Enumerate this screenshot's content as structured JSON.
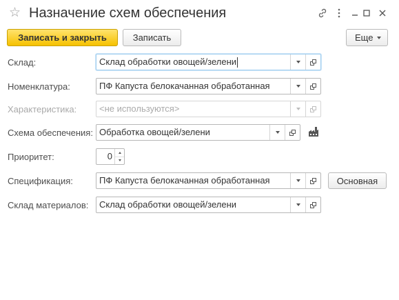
{
  "window": {
    "title": "Назначение схем обеспечения"
  },
  "toolbar": {
    "save_close_label": "Записать и закрыть",
    "save_label": "Записать",
    "more_label": "Еще"
  },
  "form": {
    "sklad": {
      "label": "Склад:",
      "value": "Склад обработки овощей/зелени"
    },
    "nomenklatura": {
      "label": "Номенклатура:",
      "value": "ПФ Капуста белокачанная обработанная"
    },
    "harakteristika": {
      "label": "Характеристика:",
      "value": "<не используются>"
    },
    "skhema": {
      "label": "Схема обеспечения:",
      "value": "Обработка овощей/зелени"
    },
    "prioritet": {
      "label": "Приоритет:",
      "value": "0"
    },
    "specifikaciya": {
      "label": "Спецификация:",
      "value": "ПФ Капуста белокачанная обработанная",
      "button_label": "Основная"
    },
    "sklad_materialov": {
      "label": "Склад материалов:",
      "value": "Склад обработки овощей/зелени"
    }
  },
  "icons": {
    "favorite": "star-icon",
    "link": "link-icon",
    "menu": "kebab-menu-icon",
    "minimize": "minimize-icon",
    "maximize": "maximize-icon",
    "close": "close-icon",
    "factory": "factory-icon"
  }
}
